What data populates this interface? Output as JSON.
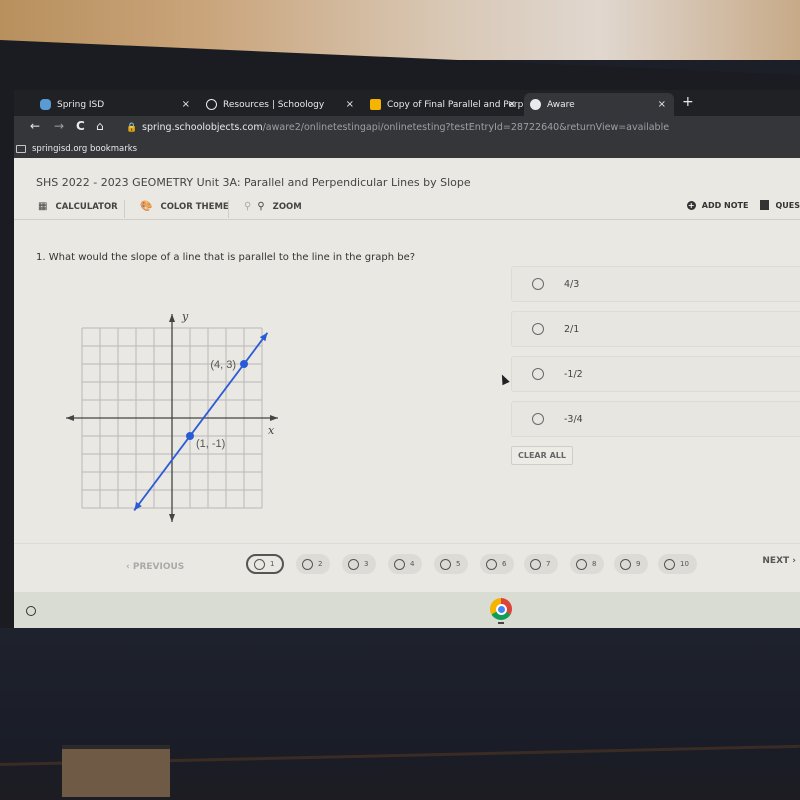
{
  "browser": {
    "tabs": [
      {
        "title": "Spring ISD",
        "icon": "cloud-icon",
        "active": false
      },
      {
        "title": "Resources | Schoology",
        "icon": "schoology-icon",
        "active": false
      },
      {
        "title": "Copy of Final Parallel and Perp",
        "icon": "slides-icon",
        "active": false
      },
      {
        "title": "Aware",
        "icon": "globe-icon",
        "active": true
      }
    ],
    "close_glyph": "×",
    "new_tab_glyph": "+",
    "nav": {
      "back": "←",
      "forward": "→",
      "reload": "C",
      "home": "⌂"
    },
    "url_host": "spring.schoolobjects.com",
    "url_path": "/aware2/onlinetestingapi/onlinetesting?testEntryId=28722640&returnView=available",
    "bookmarks_label": "springisd.org bookmarks"
  },
  "test": {
    "title": "SHS 2022 - 2023 GEOMETRY Unit 3A: Parallel and Perpendicular Lines by Slope",
    "toolbar": {
      "calculator": "CALCULATOR",
      "color_theme": "COLOR THEME",
      "zoom": "ZOOM",
      "add_note": "ADD NOTE",
      "question_flag": "QUES"
    },
    "question": {
      "number": "1.",
      "text": "What would the slope of a line that is parallel to the line in the graph be?"
    },
    "choices": [
      {
        "label": "4/3",
        "selected": false
      },
      {
        "label": "2/1",
        "selected": false
      },
      {
        "label": "-1/2",
        "selected": false
      },
      {
        "label": "-3/4",
        "selected": false
      }
    ],
    "clear_all": "CLEAR ALL",
    "nav": {
      "previous": "PREVIOUS",
      "next": "NEXT",
      "questions": [
        "1",
        "2",
        "3",
        "4",
        "5",
        "6",
        "7",
        "8",
        "9",
        "10"
      ],
      "current": 1
    }
  },
  "graph": {
    "x_axis_label": "x",
    "y_axis_label": "y",
    "x_range": [
      -5,
      5
    ],
    "y_range": [
      -5,
      5
    ],
    "points": [
      {
        "x": 4,
        "y": 3,
        "label": "(4, 3)"
      },
      {
        "x": 1,
        "y": -1,
        "label": "(1, -1)"
      }
    ],
    "line_color": "#2a5bd7"
  },
  "colors": {
    "page_bg": "#e9e8e2",
    "chrome_dark": "#202124",
    "accent_blue": "#2a5bd7"
  }
}
